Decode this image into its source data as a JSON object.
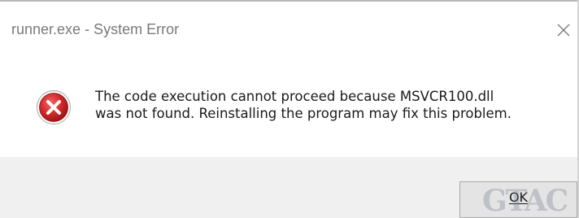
{
  "window": {
    "title": "runner.exe - System Error",
    "close_icon": "close-icon"
  },
  "message": {
    "icon": "error-icon",
    "line1": "The code execution cannot proceed because MSVCR100.dll",
    "line2": "was not found. Reinstalling the program may fix this problem."
  },
  "buttons": {
    "ok_label": "OK"
  },
  "watermark": {
    "text": "GTAC"
  },
  "colors": {
    "error_red": "#cc2a2a",
    "footer_bg": "#f0f0f0",
    "button_bg": "#e4e4e4"
  }
}
